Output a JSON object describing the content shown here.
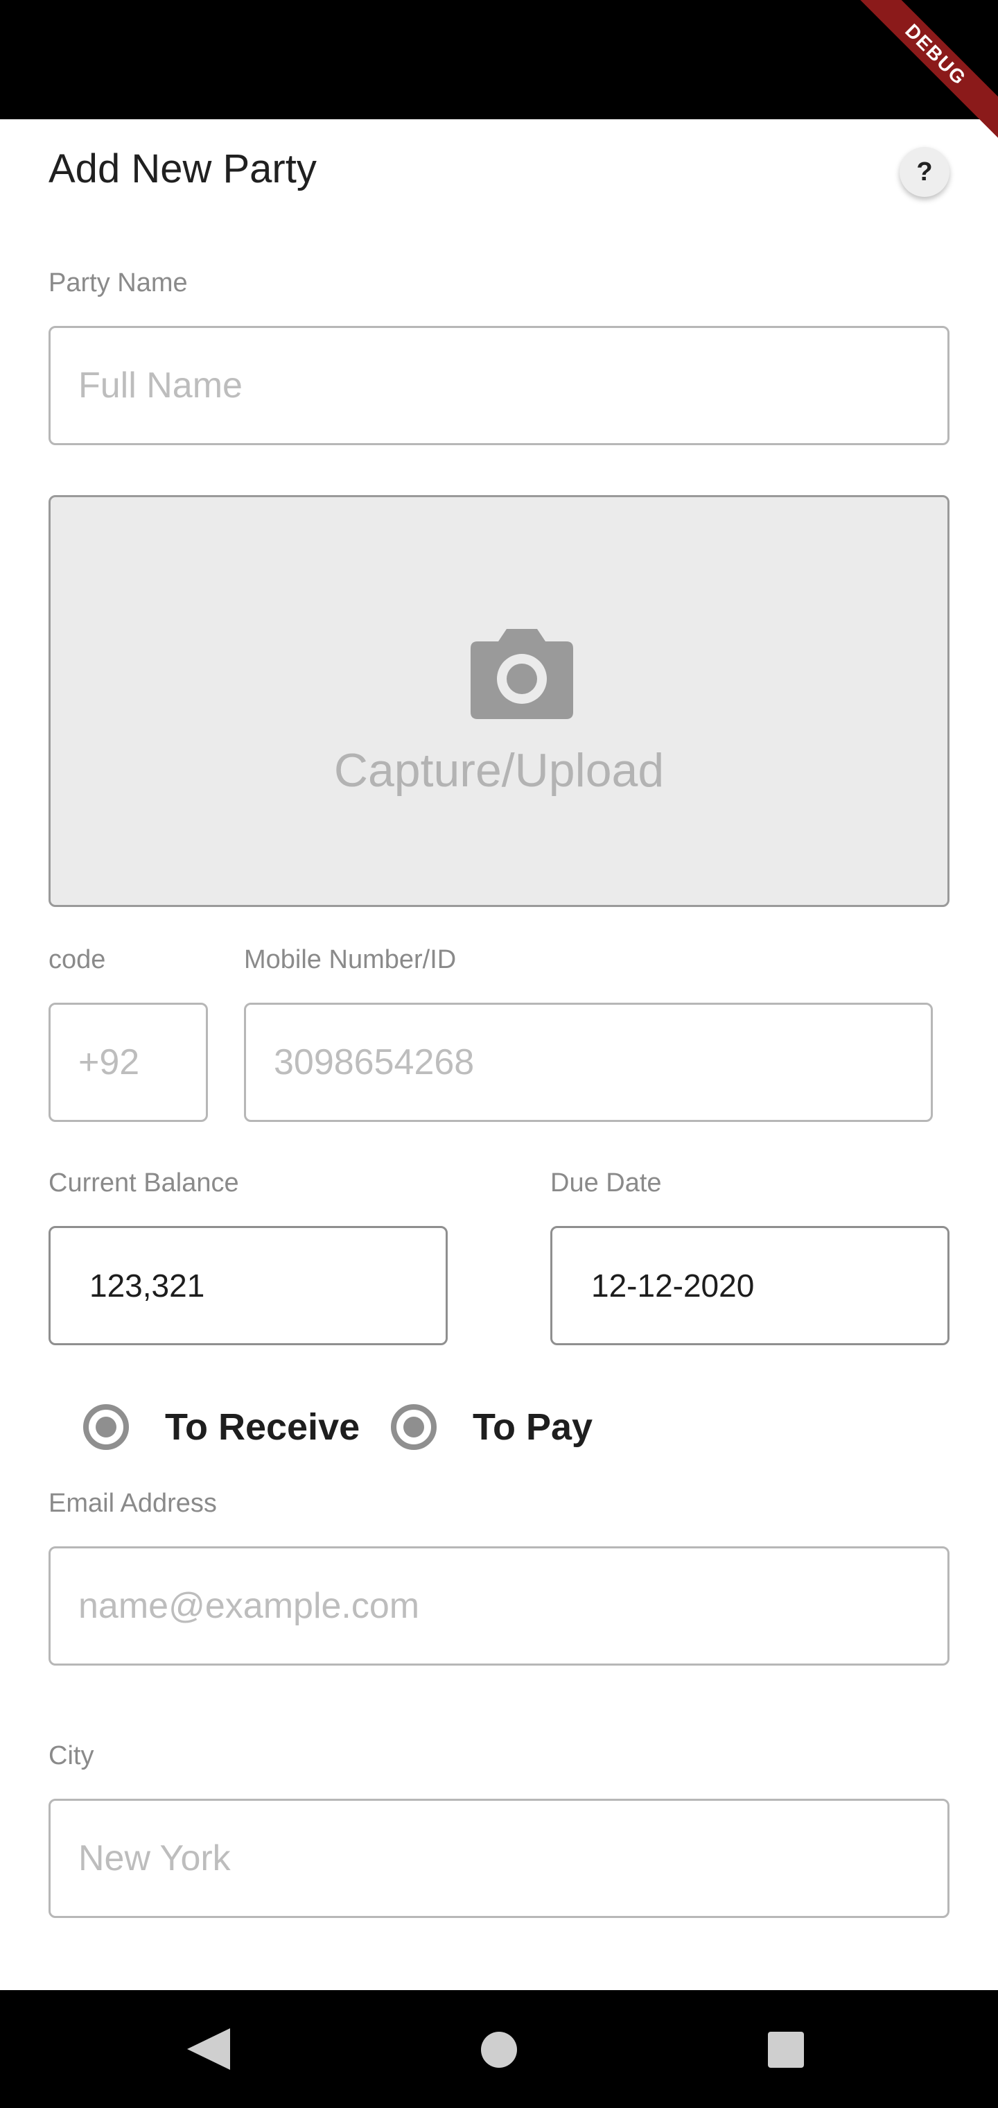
{
  "debug_banner": "DEBUG",
  "header": {
    "title": "Add New Party",
    "help_label": "?"
  },
  "party_name": {
    "label": "Party Name",
    "placeholder": "Full Name"
  },
  "photo": {
    "icon": "camera-icon",
    "label": "Capture/Upload"
  },
  "phone": {
    "code_label": "code",
    "code_placeholder": "+92",
    "number_label": "Mobile Number/ID",
    "number_placeholder": "3098654268"
  },
  "balance": {
    "label": "Current Balance",
    "value": "123,321"
  },
  "due_date": {
    "label": "Due Date",
    "value": "12-12-2020"
  },
  "transaction_type": {
    "options": [
      {
        "label": "To Receive",
        "selected": true
      },
      {
        "label": "To Pay",
        "selected": true
      }
    ],
    "accent_color": "#8f8f8f"
  },
  "email": {
    "label": "Email Address",
    "placeholder": "name@example.com"
  },
  "city": {
    "label": "City",
    "placeholder": "New York"
  },
  "nav": {
    "back_icon": "back-triangle-icon",
    "home_icon": "home-circle-icon",
    "recent_icon": "recent-square-icon"
  }
}
